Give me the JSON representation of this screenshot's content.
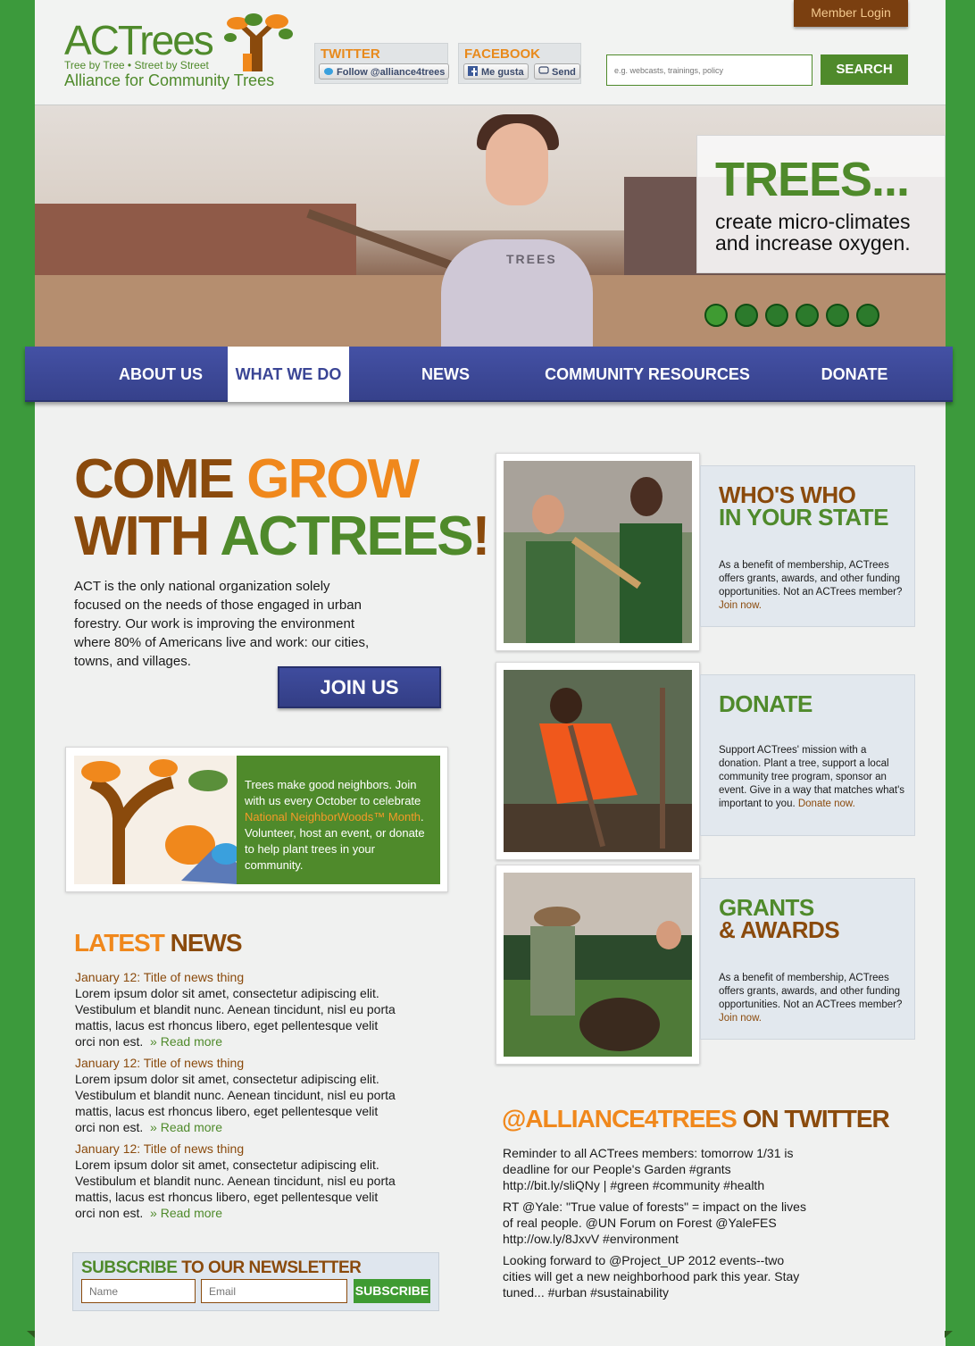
{
  "header": {
    "logo_title": "ACTrees",
    "logo_tagline": "Tree by Tree • Street by Street",
    "logo_subtitle": "Alliance for Community Trees",
    "member_login": "Member Login",
    "twitter": {
      "title": "TWITTER",
      "follow_label": "Follow @alliance4trees"
    },
    "facebook": {
      "title": "FACEBOOK",
      "like_label": "Me gusta",
      "send_label": "Send"
    },
    "search": {
      "placeholder": "e.g. webcasts, trainings, policy",
      "button": "SEARCH"
    }
  },
  "hero": {
    "shirt_text": "TREES",
    "title": "TREES...",
    "text": "create micro-climates and increase oxygen.",
    "slides": 6,
    "active_slide": 1
  },
  "nav": {
    "items": [
      {
        "label": "ABOUT US"
      },
      {
        "label": "WHAT WE DO"
      },
      {
        "label": "NEWS"
      },
      {
        "label": "COMMUNITY RESOURCES"
      },
      {
        "label": "DONATE"
      }
    ],
    "active": "WHAT WE DO"
  },
  "main": {
    "headline": {
      "w1": "COME",
      "w2": "GROW",
      "w3": "WITH",
      "w4": "ACTREES",
      "w5": "!"
    },
    "intro": "ACT is the only national organization solely focused on the needs of those engaged in urban forestry. Our work is improving the environment where 80% of Americans live and work: our cities, towns, and villages.",
    "join_button": "JOIN US",
    "promo": {
      "text_before": "Trees make good neighbors.  Join with us every October to celebrate",
      "highlight": "National NeighborWoods™ Month",
      "text_after": ". Volunteer, host an event, or donate to help plant trees in your community."
    },
    "latest_news": {
      "title_a": "LATEST",
      "title_b": "NEWS",
      "items": [
        {
          "title": "January 12: Title of news thing",
          "body": "Lorem ipsum dolor sit amet, consectetur adipiscing elit. Vestibulum et blandit nunc. Aenean tincidunt, nisl eu porta mattis, lacus est rhoncus libero, eget pellentesque velit orci non est.",
          "more": "» Read more"
        },
        {
          "title": "January 12: Title of news thing",
          "body": "Lorem ipsum dolor sit amet, consectetur adipiscing elit. Vestibulum et blandit nunc. Aenean tincidunt, nisl eu porta mattis, lacus est rhoncus libero, eget pellentesque velit orci non est.",
          "more": "» Read more"
        },
        {
          "title": "January 12: Title of news thing",
          "body": "Lorem ipsum dolor sit amet, consectetur adipiscing elit. Vestibulum et blandit nunc. Aenean tincidunt, nisl eu porta mattis, lacus est rhoncus libero, eget pellentesque velit orci non est.",
          "more": "» Read more"
        }
      ]
    },
    "newsletter": {
      "title_a": "SUBSCRIBE",
      "title_b": "TO OUR NEWSLETTER",
      "name_placeholder": "Name",
      "email_placeholder": "Email",
      "button": "SUBSCRIBE"
    }
  },
  "sidebar": {
    "cards": [
      {
        "title_a": "WHO'S WHO",
        "title_b": "IN YOUR STATE",
        "text": "As a benefit of membership, ACTrees offers grants, awards, and other funding opportunities.  Not an ACTrees member?",
        "link": "Join now."
      },
      {
        "title_a": "DONATE",
        "text": "Support ACTrees' mission with a donation.  Plant a tree, support a local community tree program, sponsor an event.  Give in a way that matches what's important to you.",
        "link": "Donate now."
      },
      {
        "title_a": "GRANTS",
        "title_b": "& AWARDS",
        "text": "As a benefit of membership, ACTrees offers grants, awards, and other funding opportunities.  Not an ACTrees member?",
        "link": "Join now."
      }
    ],
    "twitter": {
      "handle": "@ALLIANCE4TREES",
      "suffix": "ON TWITTER",
      "tweets": [
        "Reminder to all ACTrees members: tomorrow 1/31 is deadline for our People's Garden #grants http://bit.ly/sliQNy | #green #community #health",
        "RT @Yale: \"True value of forests\" = impact on the lives of real people. @UN Forum on Forest @YaleFES http://ow.ly/8JxvV #environment",
        "Looking forward to @Project_UP 2012 events--two cities will get a new neighborhood park this year. Stay tuned... #urban #sustainability"
      ]
    }
  },
  "colors": {
    "green": "#4f8a2b",
    "orange": "#f0881c",
    "brown": "#8a4a0c",
    "nav_blue": "#3a4595",
    "outer_green": "#3c9a3c"
  }
}
